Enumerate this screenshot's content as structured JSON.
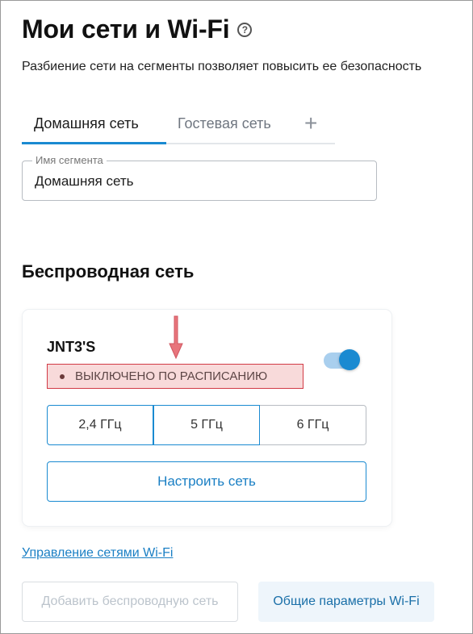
{
  "header": {
    "title": "Мои сети и Wi-Fi",
    "help_glyph": "?",
    "subtitle": "Разбиение сети на сегменты позволяет повысить ее безопасность"
  },
  "tabs": [
    {
      "label": "Домашняя сеть",
      "active": true
    },
    {
      "label": "Гостевая сеть",
      "active": false
    }
  ],
  "tab_add_glyph": "+",
  "segment_field": {
    "label": "Имя сегмента",
    "value": "Домашняя сеть"
  },
  "wireless": {
    "section_title": "Беспроводная сеть",
    "network": {
      "name": "JNT3'S",
      "enabled": true,
      "status": "ВЫКЛЮЧЕНО ПО РАСПИСАНИЮ",
      "bands": [
        "2,4 ГГц",
        "5 ГГц",
        "6 ГГц"
      ],
      "configure_label": "Настроить сеть"
    }
  },
  "links": {
    "manage": "Управление сетями Wi-Fi"
  },
  "actions": {
    "add_wireless": "Добавить беспроводную сеть",
    "wifi_params": "Общие параметры Wi-Fi"
  },
  "colors": {
    "accent": "#1a8ad1",
    "status_border": "#d23a45",
    "status_fill": "#f8dada",
    "annotation_arrow": "#e8757c"
  },
  "icons": {
    "help": "question-circle-icon",
    "add_tab": "plus-icon",
    "status": "status-dot-icon",
    "annotation": "down-arrow-icon"
  }
}
